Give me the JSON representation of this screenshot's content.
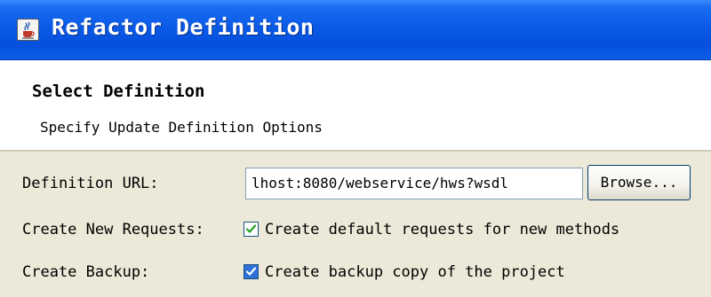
{
  "window": {
    "title": "Refactor Definition",
    "icon": "java-cup-icon"
  },
  "header": {
    "title": "Select Definition",
    "subtitle": "Specify Update Definition Options"
  },
  "form": {
    "definition_url": {
      "label": "Definition URL:",
      "value": "lhost:8080/webservice/hws?wsdl",
      "browse_label": "Browse..."
    },
    "create_new_requests": {
      "label": "Create New Requests:",
      "checkbox_label": "Create default requests for new methods",
      "checked": true
    },
    "create_backup": {
      "label": "Create Backup:",
      "checkbox_label": "Create backup copy of the project",
      "checked": true
    }
  },
  "colors": {
    "titlebar": "#0550dc",
    "dialog_bg": "#ece9d8",
    "checkbox_checked": "#2f6fd8"
  }
}
